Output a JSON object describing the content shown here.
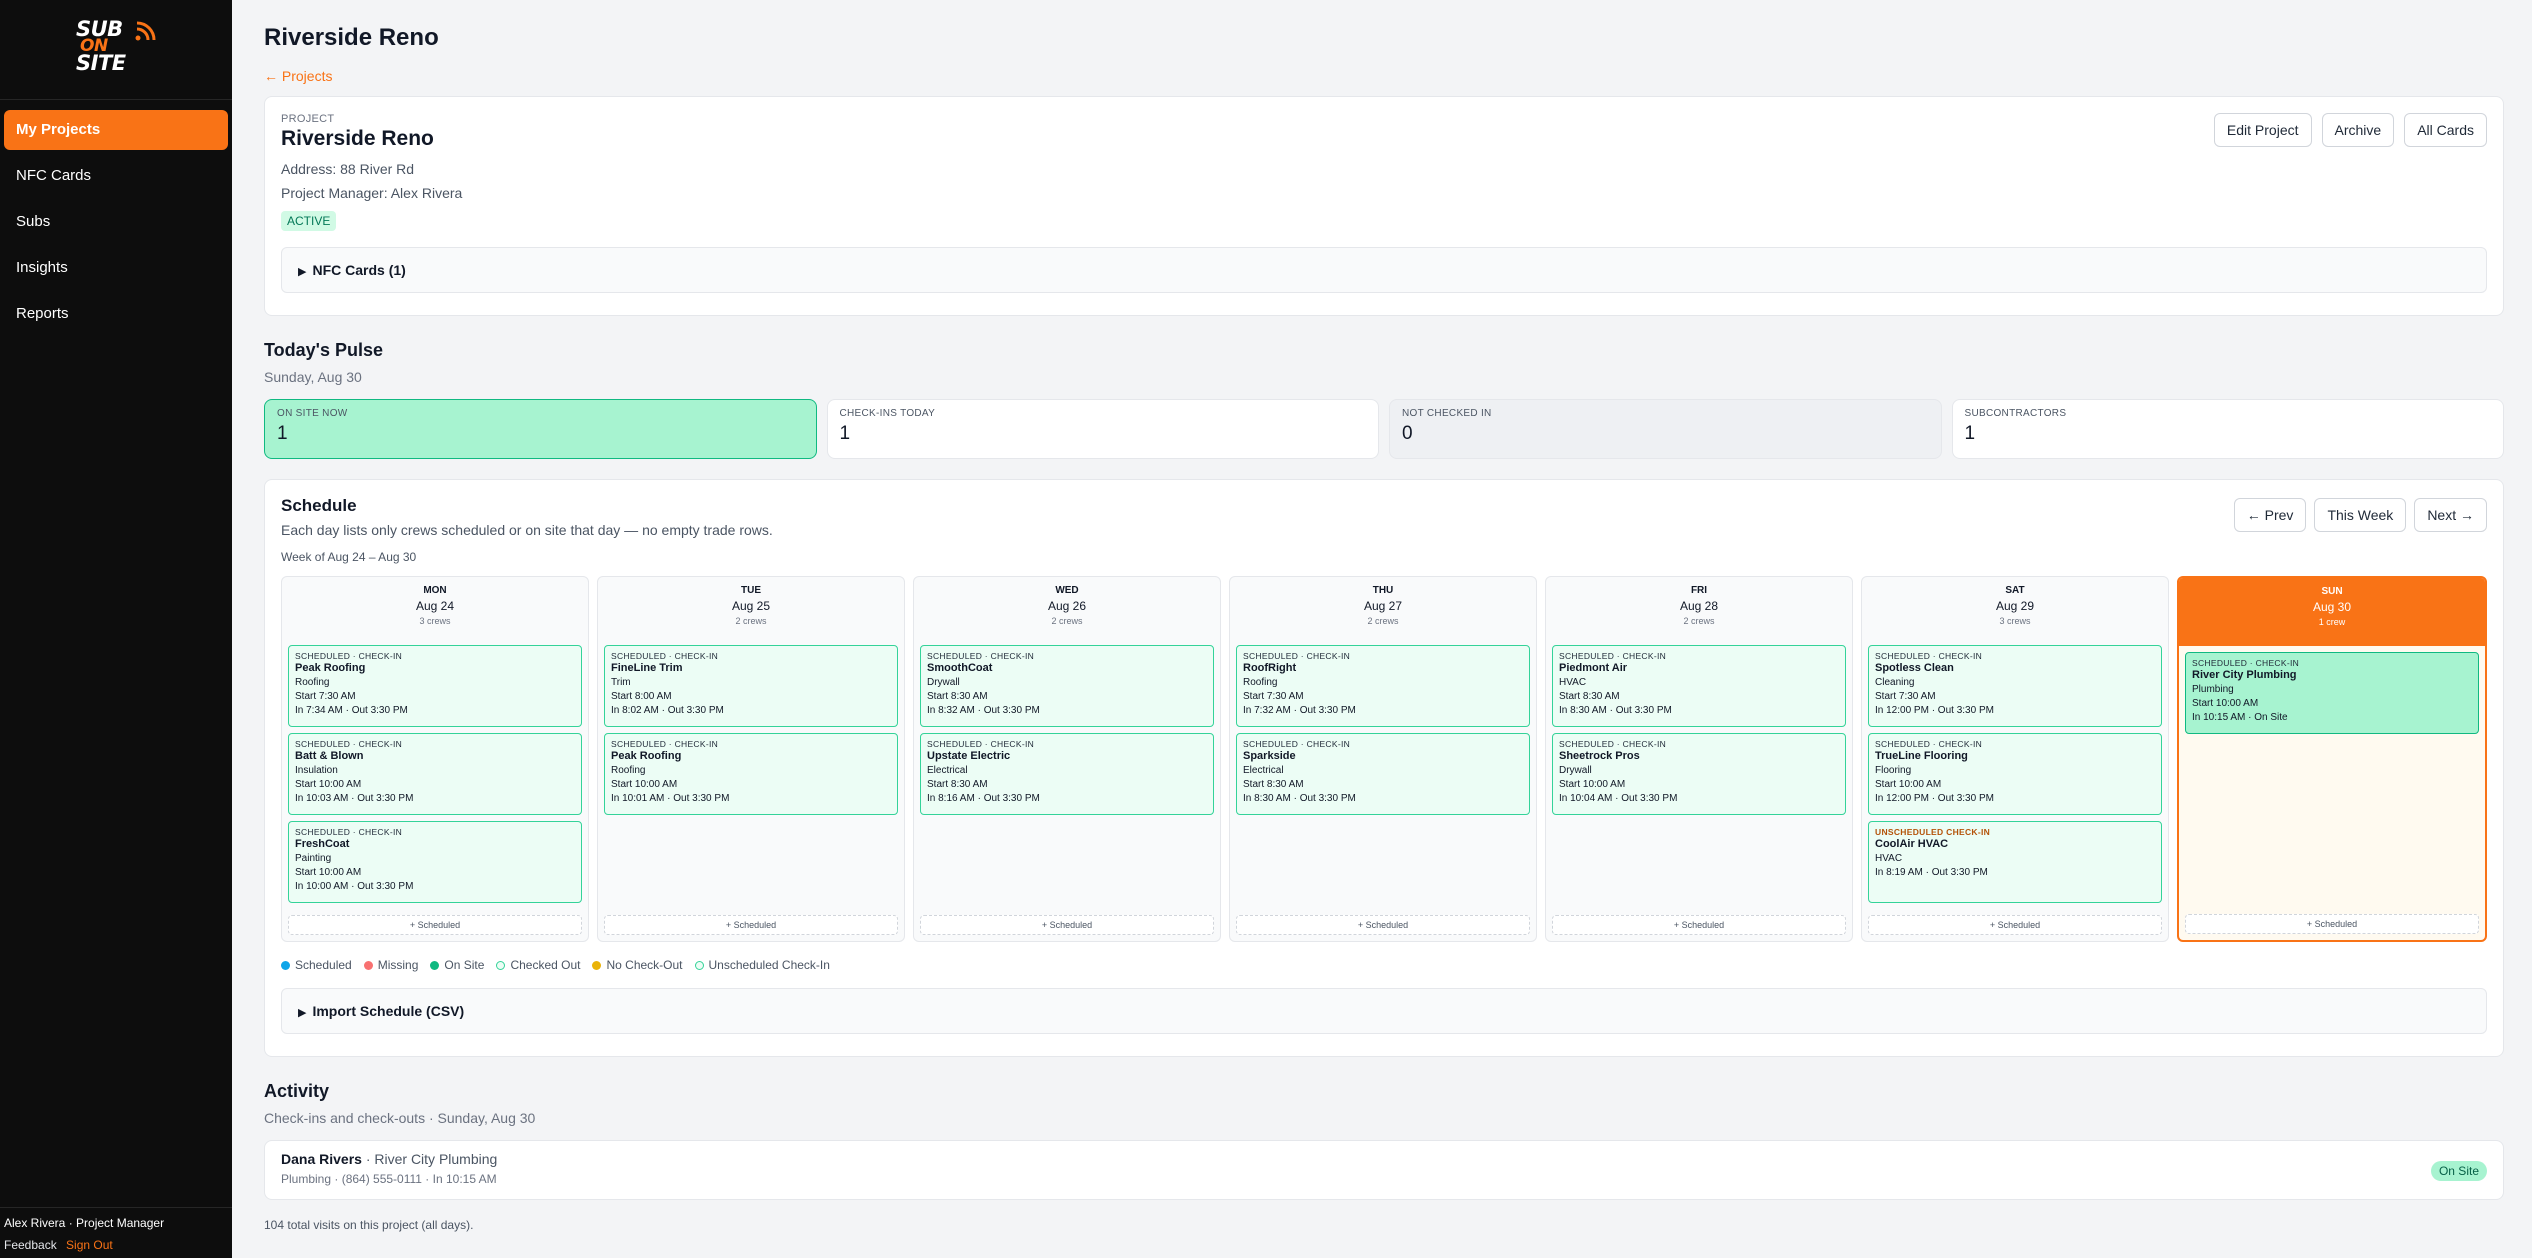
{
  "brand": {
    "line1": "SUB",
    "line2": "ON",
    "line3": "SITE",
    "accent": "#f97316"
  },
  "nav": [
    {
      "label": "My Projects",
      "active": true
    },
    {
      "label": "NFC Cards",
      "active": false
    },
    {
      "label": "Subs",
      "active": false
    },
    {
      "label": "Insights",
      "active": false
    },
    {
      "label": "Reports",
      "active": false
    }
  ],
  "user": {
    "line": "Alex Rivera · Project Manager",
    "feedback": "Feedback",
    "signout": "Sign Out"
  },
  "page": {
    "title": "Riverside Reno",
    "back": "← Projects"
  },
  "project": {
    "label": "PROJECT",
    "name": "Riverside Reno",
    "address": "Address: 88 River Rd",
    "manager": "Project Manager: Alex Rivera",
    "status": "ACTIVE",
    "buttons": {
      "edit": "Edit Project",
      "archive": "Archive",
      "all_cards": "All Cards"
    },
    "nfc": "NFC Cards (1)"
  },
  "pulse": {
    "title": "Today's Pulse",
    "date": "Sunday, Aug 30",
    "stats": [
      {
        "label": "ON SITE NOW",
        "value": "1"
      },
      {
        "label": "CHECK-INS TODAY",
        "value": "1"
      },
      {
        "label": "NOT CHECKED IN",
        "value": "0"
      },
      {
        "label": "SUBCONTRACTORS",
        "value": "1"
      }
    ]
  },
  "schedule": {
    "title": "Schedule",
    "description": "Each day lists only crews scheduled or on site that day — no empty trade rows.",
    "week": "Week of Aug 24 – Aug 30",
    "buttons": {
      "prev": "← Prev",
      "this_week": "This Week",
      "next": "Next →"
    },
    "add_label": "+ Scheduled",
    "days": [
      {
        "name": "MON",
        "date": "Aug 24",
        "crews": "3 crews",
        "entries": [
          {
            "status": "SCHEDULED · CHECK-IN",
            "company": "Peak Roofing",
            "trade": "Roofing",
            "start": "Start 7:30 AM",
            "inout": "In 7:34 AM · Out 3:30 PM"
          },
          {
            "status": "SCHEDULED · CHECK-IN",
            "company": "Batt & Blown",
            "trade": "Insulation",
            "start": "Start 10:00 AM",
            "inout": "In 10:03 AM · Out 3:30 PM"
          },
          {
            "status": "SCHEDULED · CHECK-IN",
            "company": "FreshCoat",
            "trade": "Painting",
            "start": "Start 10:00 AM",
            "inout": "In 10:00 AM · Out 3:30 PM"
          }
        ]
      },
      {
        "name": "TUE",
        "date": "Aug 25",
        "crews": "2 crews",
        "entries": [
          {
            "status": "SCHEDULED · CHECK-IN",
            "company": "FineLine Trim",
            "trade": "Trim",
            "start": "Start 8:00 AM",
            "inout": "In 8:02 AM · Out 3:30 PM"
          },
          {
            "status": "SCHEDULED · CHECK-IN",
            "company": "Peak Roofing",
            "trade": "Roofing",
            "start": "Start 10:00 AM",
            "inout": "In 10:01 AM · Out 3:30 PM"
          }
        ]
      },
      {
        "name": "WED",
        "date": "Aug 26",
        "crews": "2 crews",
        "entries": [
          {
            "status": "SCHEDULED · CHECK-IN",
            "company": "SmoothCoat",
            "trade": "Drywall",
            "start": "Start 8:30 AM",
            "inout": "In 8:32 AM · Out 3:30 PM"
          },
          {
            "status": "SCHEDULED · CHECK-IN",
            "company": "Upstate Electric",
            "trade": "Electrical",
            "start": "Start 8:30 AM",
            "inout": "In 8:16 AM · Out 3:30 PM"
          }
        ]
      },
      {
        "name": "THU",
        "date": "Aug 27",
        "crews": "2 crews",
        "entries": [
          {
            "status": "SCHEDULED · CHECK-IN",
            "company": "RoofRight",
            "trade": "Roofing",
            "start": "Start 7:30 AM",
            "inout": "In 7:32 AM · Out 3:30 PM"
          },
          {
            "status": "SCHEDULED · CHECK-IN",
            "company": "Sparkside",
            "trade": "Electrical",
            "start": "Start 8:30 AM",
            "inout": "In 8:30 AM · Out 3:30 PM"
          }
        ]
      },
      {
        "name": "FRI",
        "date": "Aug 28",
        "crews": "2 crews",
        "entries": [
          {
            "status": "SCHEDULED · CHECK-IN",
            "company": "Piedmont Air",
            "trade": "HVAC",
            "start": "Start 8:30 AM",
            "inout": "In 8:30 AM · Out 3:30 PM"
          },
          {
            "status": "SCHEDULED · CHECK-IN",
            "company": "Sheetrock Pros",
            "trade": "Drywall",
            "start": "Start 10:00 AM",
            "inout": "In 10:04 AM · Out 3:30 PM"
          }
        ]
      },
      {
        "name": "SAT",
        "date": "Aug 29",
        "crews": "3 crews",
        "entries": [
          {
            "status": "SCHEDULED · CHECK-IN",
            "company": "Spotless Clean",
            "trade": "Cleaning",
            "start": "Start 7:30 AM",
            "inout": "In 12:00 PM · Out 3:30 PM"
          },
          {
            "status": "SCHEDULED · CHECK-IN",
            "company": "TrueLine Flooring",
            "trade": "Flooring",
            "start": "Start 10:00 AM",
            "inout": "In 12:00 PM · Out 3:30 PM"
          },
          {
            "status": "UNSCHEDULED CHECK-IN",
            "company": "CoolAir HVAC",
            "trade": "HVAC",
            "start": "",
            "inout": "In 8:19 AM · Out 3:30 PM",
            "unscheduled": true
          }
        ]
      },
      {
        "name": "SUN",
        "date": "Aug 30",
        "crews": "1 crew",
        "today": true,
        "entries": [
          {
            "status": "SCHEDULED · CHECK-IN",
            "company": "River City Plumbing",
            "trade": "Plumbing",
            "start": "Start 10:00 AM",
            "inout": "In 10:15 AM · On Site",
            "onsite": true
          }
        ]
      }
    ],
    "legend": [
      {
        "label": "Scheduled",
        "color": "#0ea5e9",
        "fill": true
      },
      {
        "label": "Missing",
        "color": "#f87171",
        "fill": true
      },
      {
        "label": "On Site",
        "color": "#10b981",
        "fill": true
      },
      {
        "label": "Checked Out",
        "color": "#34d399",
        "fill": false
      },
      {
        "label": "No Check-Out",
        "color": "#eab308",
        "fill": true
      },
      {
        "label": "Unscheduled Check-In",
        "color": "#34d399",
        "fill": false
      }
    ],
    "import": "Import Schedule (CSV)"
  },
  "activity": {
    "title": "Activity",
    "subtitle": "Check-ins and check-outs · Sunday, Aug 30",
    "rows": [
      {
        "name": "Dana Rivers",
        "company": " · River City Plumbing",
        "detail": "Plumbing · (864) 555-0111 · In 10:15 AM",
        "status": "On Site"
      }
    ],
    "total": "104 total visits on this project (all days)."
  }
}
